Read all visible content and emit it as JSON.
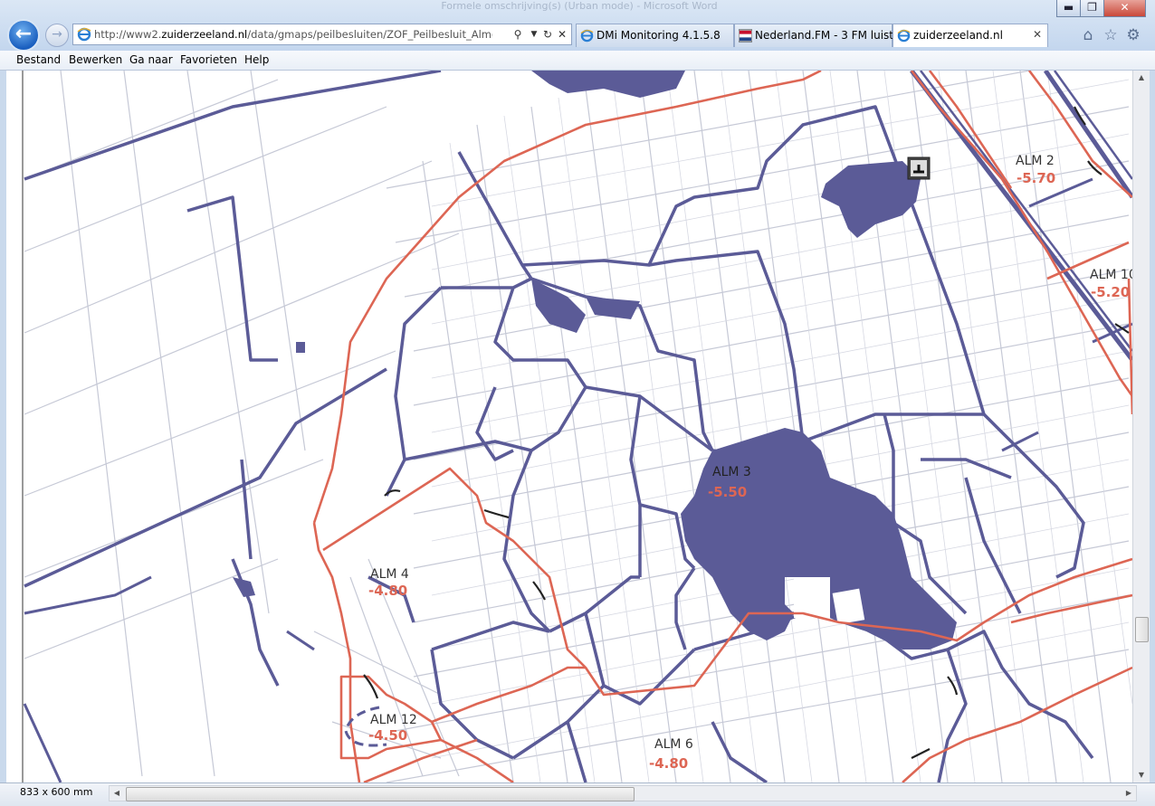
{
  "window": {
    "title": "Formele omschrijving(s) (Urban mode) - Microsoft Word"
  },
  "browser": {
    "address": {
      "url_prefix": "http://www2.",
      "url_domain": "zuiderzeeland.nl",
      "url_suffix": "/data/gmaps/peilbesluiten/ZOF_Peilbesluit_Almere_stede"
    },
    "tabs": [
      {
        "label": "DMi Monitoring 4.1.5.8",
        "icon": "ie-icon"
      },
      {
        "label": "Nederland.FM - 3 FM luist...",
        "icon": "flag-icon"
      },
      {
        "label": "zuiderzeeland.nl",
        "icon": "ie-icon",
        "active": true
      }
    ],
    "menu": [
      "Bestand",
      "Bewerken",
      "Ga naar",
      "Favorieten",
      "Help"
    ],
    "status": {
      "dimensions": "833 x 600 mm"
    }
  },
  "map": {
    "areas": [
      {
        "name": "ALM 2",
        "level": "-5.70"
      },
      {
        "name": "ALM 10",
        "level": "-5.20"
      },
      {
        "name": "ALM 3",
        "level": "-5.50"
      },
      {
        "name": "ALM 4",
        "level": "-4.80"
      },
      {
        "name": "ALM 12",
        "level": "-4.50"
      },
      {
        "name": "ALM 6",
        "level": "-4.80"
      }
    ],
    "colors": {
      "water": "#5b5b97",
      "boundary": "#dd6654",
      "level_text": "#dd6654",
      "street": "#c6c9d6"
    }
  }
}
